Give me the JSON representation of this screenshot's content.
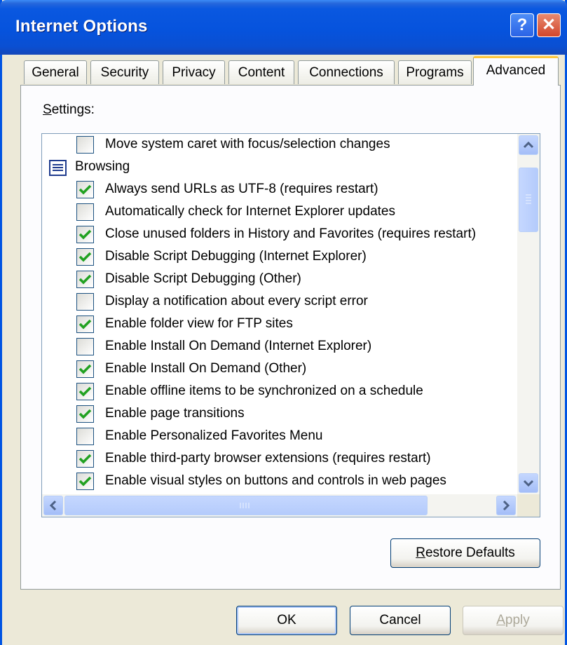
{
  "window": {
    "title": "Internet Options"
  },
  "titlebar": {
    "help_glyph": "?",
    "close_glyph": "✕"
  },
  "tabs": [
    {
      "label": "General"
    },
    {
      "label": "Security"
    },
    {
      "label": "Privacy"
    },
    {
      "label": "Content"
    },
    {
      "label": "Connections"
    },
    {
      "label": "Programs"
    },
    {
      "label": "Advanced",
      "active": true
    }
  ],
  "settings": {
    "label_prefix": "",
    "label_accel": "S",
    "label_rest": "ettings:",
    "items": [
      {
        "type": "checkbox",
        "checked": false,
        "label": "Move system caret with focus/selection changes"
      },
      {
        "type": "category",
        "label": "Browsing",
        "icon": "settings-category-icon"
      },
      {
        "type": "checkbox",
        "checked": true,
        "label": "Always send URLs as UTF-8 (requires restart)"
      },
      {
        "type": "checkbox",
        "checked": false,
        "label": "Automatically check for Internet Explorer updates"
      },
      {
        "type": "checkbox",
        "checked": true,
        "label": "Close unused folders in History and Favorites (requires restart)"
      },
      {
        "type": "checkbox",
        "checked": true,
        "label": "Disable Script Debugging (Internet Explorer)"
      },
      {
        "type": "checkbox",
        "checked": true,
        "label": "Disable Script Debugging (Other)"
      },
      {
        "type": "checkbox",
        "checked": false,
        "label": "Display a notification about every script error"
      },
      {
        "type": "checkbox",
        "checked": true,
        "label": "Enable folder view for FTP sites"
      },
      {
        "type": "checkbox",
        "checked": false,
        "label": "Enable Install On Demand (Internet Explorer)"
      },
      {
        "type": "checkbox",
        "checked": true,
        "label": "Enable Install On Demand (Other)"
      },
      {
        "type": "checkbox",
        "checked": true,
        "label": "Enable offline items to be synchronized on a schedule"
      },
      {
        "type": "checkbox",
        "checked": true,
        "label": "Enable page transitions"
      },
      {
        "type": "checkbox",
        "checked": false,
        "label": "Enable Personalized Favorites Menu"
      },
      {
        "type": "checkbox",
        "checked": true,
        "label": "Enable third-party browser extensions (requires restart)"
      },
      {
        "type": "checkbox",
        "checked": true,
        "label": "Enable visual styles on buttons and controls in web pages"
      }
    ]
  },
  "buttons": {
    "restore_accel": "R",
    "restore_rest": "estore Defaults",
    "ok": "OK",
    "cancel": "Cancel",
    "apply_accel": "A",
    "apply_rest": "pply"
  },
  "colors": {
    "titlebar": "#0A58E0",
    "check": "#21A121",
    "dialog_bg": "#ECE9D8",
    "active_tab_accent": "#FFC73C"
  }
}
